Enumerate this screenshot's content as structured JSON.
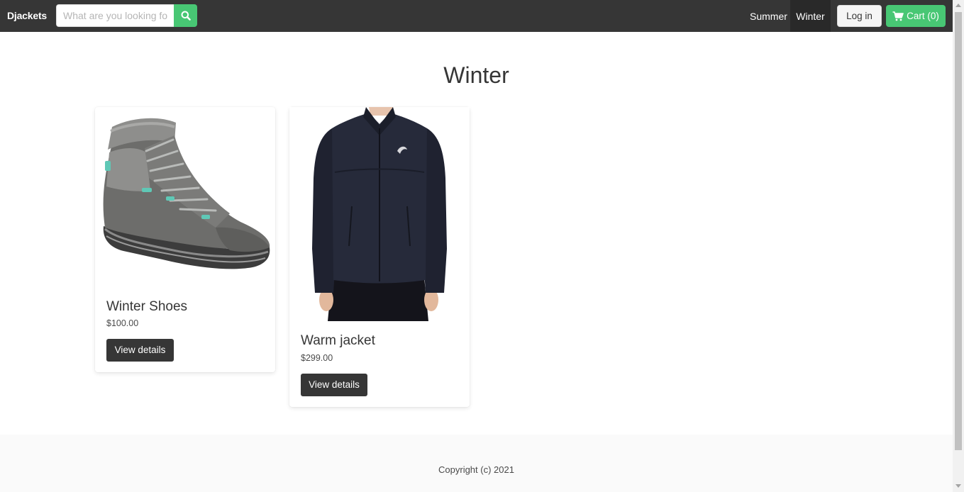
{
  "navbar": {
    "brand": "Djackets",
    "search": {
      "placeholder": "What are you looking for?",
      "value": ""
    },
    "links": [
      {
        "label": "Summer",
        "active": false
      },
      {
        "label": "Winter",
        "active": true
      }
    ],
    "login_label": "Log in",
    "cart_label": "Cart (0)"
  },
  "page": {
    "title": "Winter"
  },
  "products": [
    {
      "name": "Winter Shoes",
      "price": "$100.00",
      "button": "View details",
      "image_icon": "winter-boot"
    },
    {
      "name": "Warm jacket",
      "price": "$299.00",
      "button": "View details",
      "image_icon": "dark-softshell-jacket"
    }
  ],
  "footer": {
    "copyright": "Copyright (c) 2021"
  },
  "colors": {
    "navbar_bg": "#363636",
    "active_link_bg": "#292929",
    "success_green": "#48c774",
    "dark_button": "#363636",
    "footer_bg": "#fafafa"
  }
}
